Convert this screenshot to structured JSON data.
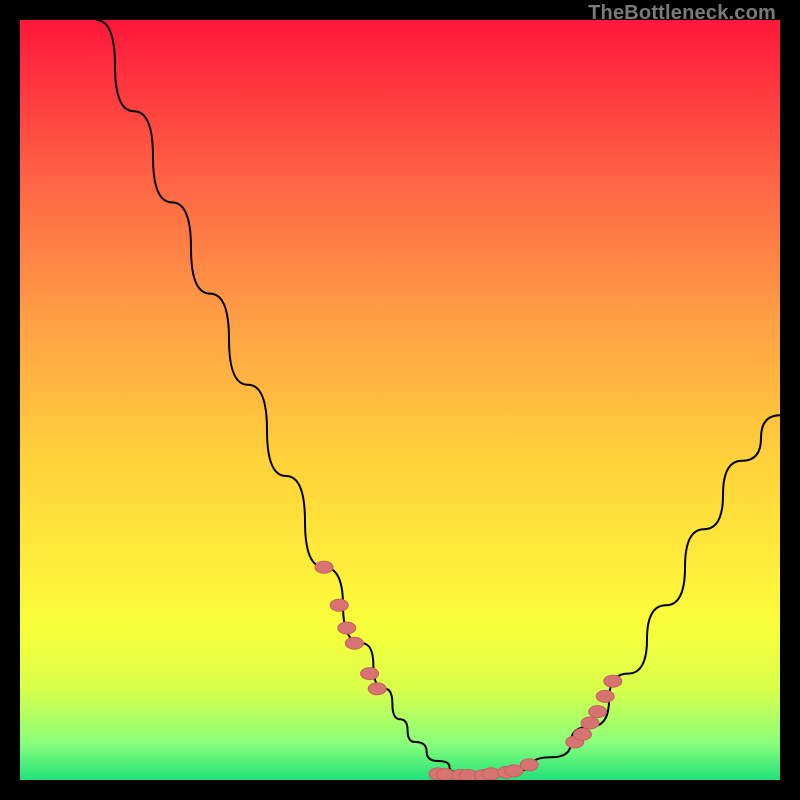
{
  "watermark": {
    "text": "TheBottleneck.com"
  },
  "colors": {
    "curve": "#000000",
    "marker_fill": "#d77472",
    "marker_stroke": "#c5605e",
    "gradient": [
      "#ff173a",
      "#ff6745",
      "#ffa145",
      "#ffd23a",
      "#ffe93a",
      "#f8ff3a",
      "#d8ff4a",
      "#8cff7a",
      "#22e27a"
    ]
  },
  "chart_data": {
    "type": "line",
    "title": "",
    "xlabel": "",
    "ylabel": "",
    "xlim": [
      0,
      100
    ],
    "ylim": [
      0,
      100
    ],
    "grid": false,
    "series": [
      {
        "name": "curve",
        "x": [
          10,
          15,
          20,
          25,
          30,
          35,
          40,
          45,
          48,
          50,
          52,
          55,
          58,
          60,
          62,
          65,
          70,
          75,
          80,
          85,
          90,
          95,
          100
        ],
        "y": [
          100,
          88,
          76,
          64,
          52,
          40,
          28,
          18,
          12,
          8,
          5,
          2.5,
          1,
          0.5,
          0.6,
          1.2,
          3,
          7,
          14,
          23,
          33,
          42,
          48
        ]
      }
    ],
    "markers": [
      {
        "x": 40,
        "y": 28
      },
      {
        "x": 42,
        "y": 23
      },
      {
        "x": 43,
        "y": 20
      },
      {
        "x": 44,
        "y": 18
      },
      {
        "x": 46,
        "y": 14
      },
      {
        "x": 47,
        "y": 12
      },
      {
        "x": 55,
        "y": 0.8
      },
      {
        "x": 56,
        "y": 0.7
      },
      {
        "x": 58,
        "y": 0.6
      },
      {
        "x": 59,
        "y": 0.6
      },
      {
        "x": 61,
        "y": 0.6
      },
      {
        "x": 62,
        "y": 0.8
      },
      {
        "x": 64,
        "y": 1.0
      },
      {
        "x": 65,
        "y": 1.2
      },
      {
        "x": 67,
        "y": 2.0
      },
      {
        "x": 73,
        "y": 5.0
      },
      {
        "x": 74,
        "y": 6.0
      },
      {
        "x": 75,
        "y": 7.5
      },
      {
        "x": 76,
        "y": 9.0
      },
      {
        "x": 77,
        "y": 11.0
      },
      {
        "x": 78,
        "y": 13.0
      }
    ]
  }
}
